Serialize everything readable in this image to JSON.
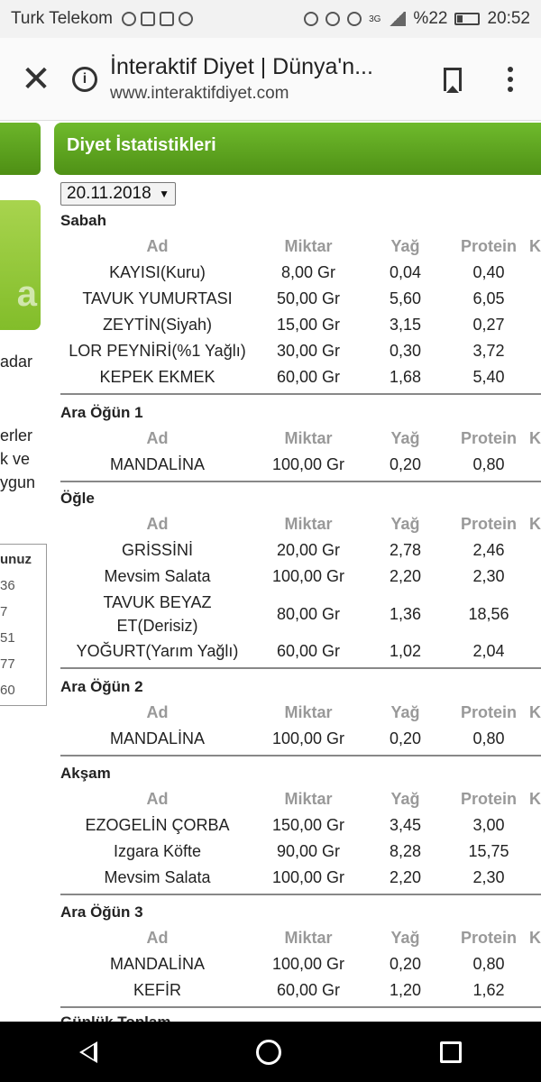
{
  "status_bar": {
    "carrier": "Turk Telekom",
    "network": "3G",
    "battery": "%22",
    "time": "20:52"
  },
  "browser": {
    "title": "İnteraktif Diyet | Dünya'n...",
    "url": "www.interaktifdiyet.com"
  },
  "left_panel": {
    "text_lines": [
      "adar",
      "erler",
      "k  ve",
      "ygun"
    ],
    "box_header": "unuz",
    "box_values": [
      "36",
      "7",
      "51",
      "77",
      "60"
    ]
  },
  "section_title": "Diyet İstatistikleri",
  "date": "20.11.2018",
  "columns": {
    "ad": "Ad",
    "miktar": "Miktar",
    "yag": "Yağ",
    "protein": "Protein",
    "k": "K"
  },
  "meals": [
    {
      "name": "Sabah",
      "items": [
        {
          "ad": "KAYISI(Kuru)",
          "miktar": "8,00 Gr",
          "yag": "0,04",
          "protein": "0,40"
        },
        {
          "ad": "TAVUK YUMURTASI",
          "miktar": "50,00 Gr",
          "yag": "5,60",
          "protein": "6,05"
        },
        {
          "ad": "ZEYTİN(Siyah)",
          "miktar": "15,00 Gr",
          "yag": "3,15",
          "protein": "0,27"
        },
        {
          "ad": "LOR PEYNİRİ(%1 Yağlı)",
          "miktar": "30,00 Gr",
          "yag": "0,30",
          "protein": "3,72"
        },
        {
          "ad": "KEPEK EKMEK",
          "miktar": "60,00 Gr",
          "yag": "1,68",
          "protein": "5,40"
        }
      ]
    },
    {
      "name": "Ara Öğün 1",
      "items": [
        {
          "ad": "MANDALİNA",
          "miktar": "100,00 Gr",
          "yag": "0,20",
          "protein": "0,80"
        }
      ]
    },
    {
      "name": "Öğle",
      "items": [
        {
          "ad": "GRİSSİNİ",
          "miktar": "20,00 Gr",
          "yag": "2,78",
          "protein": "2,46"
        },
        {
          "ad": "Mevsim Salata",
          "miktar": "100,00 Gr",
          "yag": "2,20",
          "protein": "2,30"
        },
        {
          "ad": "TAVUK BEYAZ ET(Derisiz)",
          "miktar": "80,00 Gr",
          "yag": "1,36",
          "protein": "18,56"
        },
        {
          "ad": "YOĞURT(Yarım Yağlı)",
          "miktar": "60,00 Gr",
          "yag": "1,02",
          "protein": "2,04"
        }
      ]
    },
    {
      "name": "Ara Öğün 2",
      "items": [
        {
          "ad": "MANDALİNA",
          "miktar": "100,00 Gr",
          "yag": "0,20",
          "protein": "0,80"
        }
      ]
    },
    {
      "name": "Akşam",
      "items": [
        {
          "ad": "EZOGELİN ÇORBA",
          "miktar": "150,00 Gr",
          "yag": "3,45",
          "protein": "3,00"
        },
        {
          "ad": "Izgara Köfte",
          "miktar": "90,00 Gr",
          "yag": "8,28",
          "protein": "15,75"
        },
        {
          "ad": "Mevsim Salata",
          "miktar": "100,00 Gr",
          "yag": "2,20",
          "protein": "2,30"
        }
      ]
    },
    {
      "name": "Ara Öğün 3",
      "items": [
        {
          "ad": "MANDALİNA",
          "miktar": "100,00 Gr",
          "yag": "0,20",
          "protein": "0,80"
        },
        {
          "ad": "KEFİR",
          "miktar": "60,00 Gr",
          "yag": "1,20",
          "protein": "1,62"
        }
      ]
    }
  ],
  "next_section_peek": "Günlük Toplam"
}
